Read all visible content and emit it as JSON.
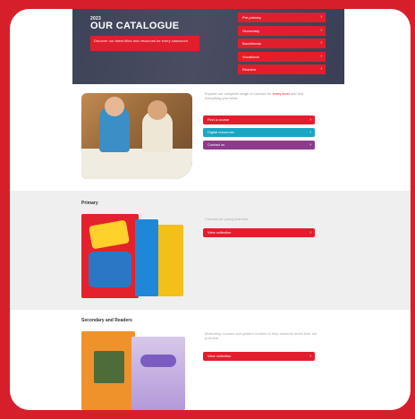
{
  "hero": {
    "kicker": "2023",
    "title": "OUR CATALOGUE",
    "banner_text": "Discover our latest titles and resources for every classroom",
    "menu": [
      {
        "label": "Pre-primary"
      },
      {
        "label": "Secondary"
      },
      {
        "label": "Bachillerato"
      },
      {
        "label": "Vocational"
      },
      {
        "label": "Readers"
      }
    ]
  },
  "intro": {
    "text_start": "Explore our complete range of courses for",
    "text_highlight": "every level",
    "text_end": "and find everything you need.",
    "buttons": [
      {
        "label": "Find a course"
      },
      {
        "label": "Digital resources"
      },
      {
        "label": "Contact us"
      }
    ]
  },
  "primary": {
    "title": "Primary",
    "text": "Courses for young learners",
    "button": "View collection"
  },
  "secondary": {
    "title": "Secondary and Readers",
    "text": "Motivating courses and graded readers to help students reach their full potential.",
    "button": "View collection"
  },
  "colors": {
    "brand_red": "#e21e2d",
    "cyan": "#1aa6c4",
    "purple": "#8e3a8e",
    "hero_bg": "#41465b"
  }
}
